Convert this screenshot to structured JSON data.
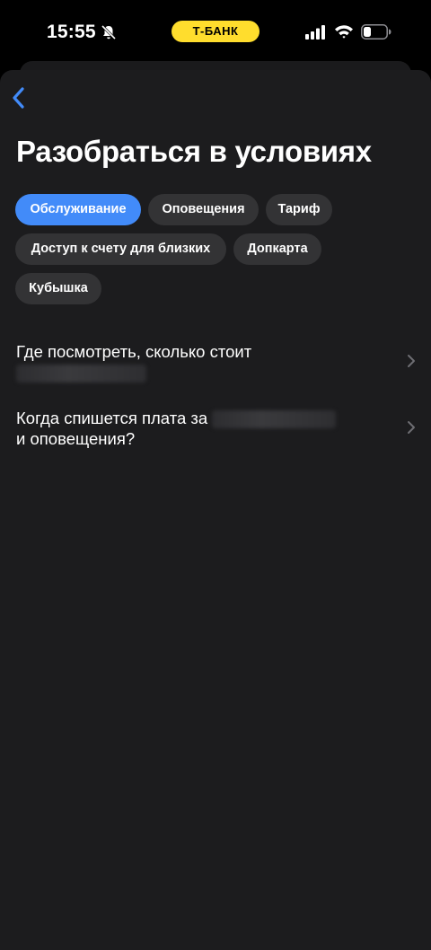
{
  "status_bar": {
    "time": "15:55",
    "brand": "Т-БАНК",
    "icons": [
      "bell-slash-icon",
      "signal-icon",
      "wifi-icon",
      "battery-icon"
    ]
  },
  "header": {
    "back_icon": "chevron-left-icon",
    "title": "Разобраться в условиях"
  },
  "chips": [
    {
      "label": "Обслуживание",
      "active": true
    },
    {
      "label": "Оповещения",
      "active": false
    },
    {
      "label": "Тариф",
      "active": false
    },
    {
      "label": "Доступ к счету для близких",
      "active": false
    },
    {
      "label": "Допкарта",
      "active": false
    },
    {
      "label": "Кубышка",
      "active": false
    }
  ],
  "faq": [
    {
      "line1": "Где посмотреть, сколько стоит",
      "line2": ""
    },
    {
      "line1": "Когда спишется плата за",
      "line2": "и оповещения?"
    }
  ],
  "colors": {
    "accent": "#428bf9",
    "brand_yellow": "#ffdd2d",
    "background": "#1c1c1e",
    "chip": "#333335"
  }
}
